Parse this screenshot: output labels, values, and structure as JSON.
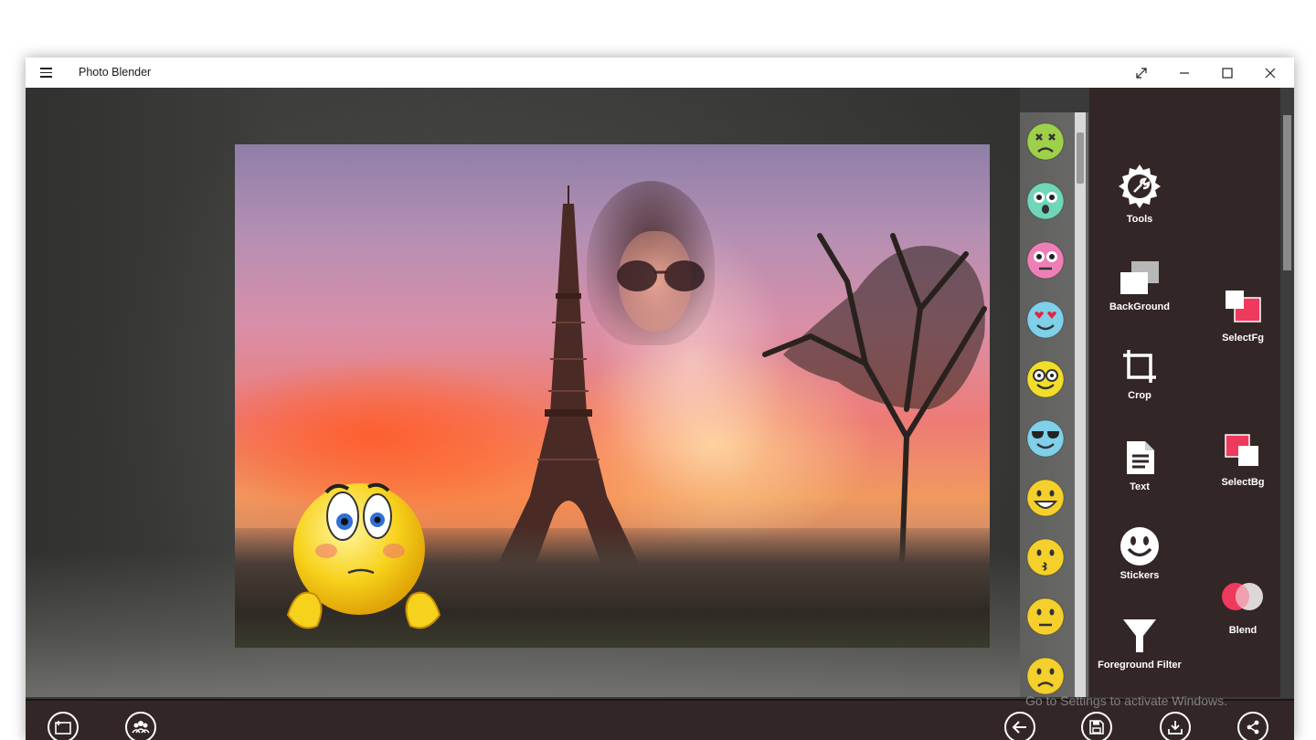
{
  "window": {
    "title": "Photo Blender"
  },
  "titlebar": {
    "menu_icon": "hamburger-icon",
    "fullscreen_icon": "expand-icon",
    "minimize_icon": "minimize-icon",
    "maximize_icon": "maximize-icon",
    "close_icon": "close-icon"
  },
  "emojis": [
    "sick-face-icon",
    "shocked-face-icon",
    "pink-scared-face-icon",
    "heart-eyes-face-icon",
    "nerd-glasses-face-icon",
    "sunglasses-face-icon",
    "grinning-face-icon",
    "kiss-face-icon",
    "thinking-face-icon",
    "worried-face-icon"
  ],
  "tools": {
    "tools_label": "Tools",
    "background_label": "BackGround",
    "select_fg_label": "SelectFg",
    "crop_label": "Crop",
    "text_label": "Text",
    "select_bg_label": "SelectBg",
    "stickers_label": "Stickers",
    "blend_label": "Blend",
    "foreground_filter_label": "Foreground Filter"
  },
  "bottom": {
    "open_icon": "open-image-icon",
    "group_icon": "people-group-icon",
    "back_icon": "back-arrow-icon",
    "save_icon": "save-icon",
    "download_icon": "download-icon",
    "share_icon": "share-icon"
  },
  "watermark": "Go to Settings to activate Windows.",
  "colors": {
    "panel": "#332627",
    "accent_pink": "#ee3a5c",
    "emoji_yellow": "#f5d21a"
  }
}
